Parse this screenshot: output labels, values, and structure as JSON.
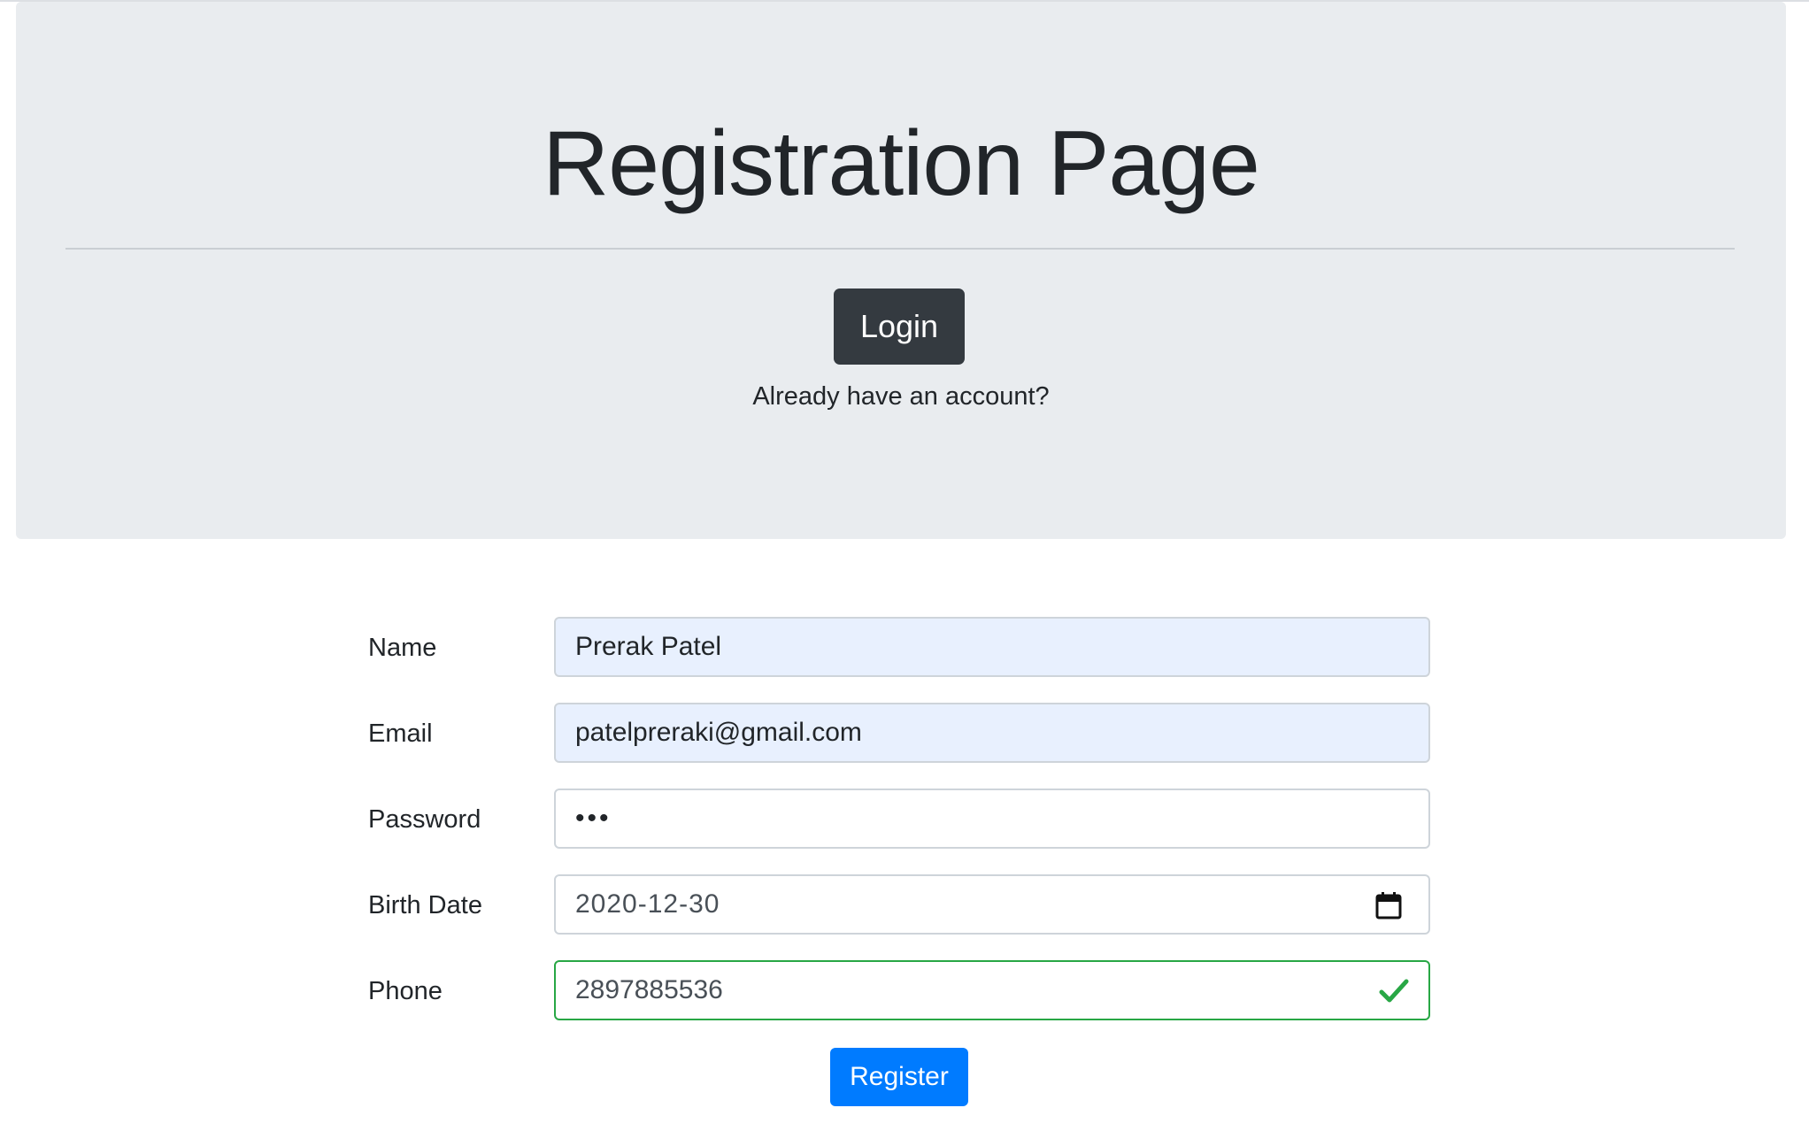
{
  "header": {
    "title": "Registration Page",
    "login_label": "Login",
    "account_prompt": "Already have an account?"
  },
  "form": {
    "fields": [
      {
        "label": "Name",
        "value": "Prerak Patel",
        "type": "text"
      },
      {
        "label": "Email",
        "value": "patelpreraki@gmail.com",
        "type": "email"
      },
      {
        "label": "Password",
        "value": "•••",
        "type": "password"
      },
      {
        "label": "Birth Date",
        "value": "2020-12-30",
        "type": "date",
        "icon": "calendar-icon"
      },
      {
        "label": "Phone",
        "value": "2897885536",
        "type": "tel",
        "status": "valid",
        "icon": "check-icon"
      }
    ],
    "submit_label": "Register"
  },
  "colors": {
    "jumbotron_bg": "#e9ecef",
    "login_bg": "#343a40",
    "register_bg": "#007bff",
    "valid_border": "#28a745",
    "autofill_bg": "#e8f0fe"
  }
}
